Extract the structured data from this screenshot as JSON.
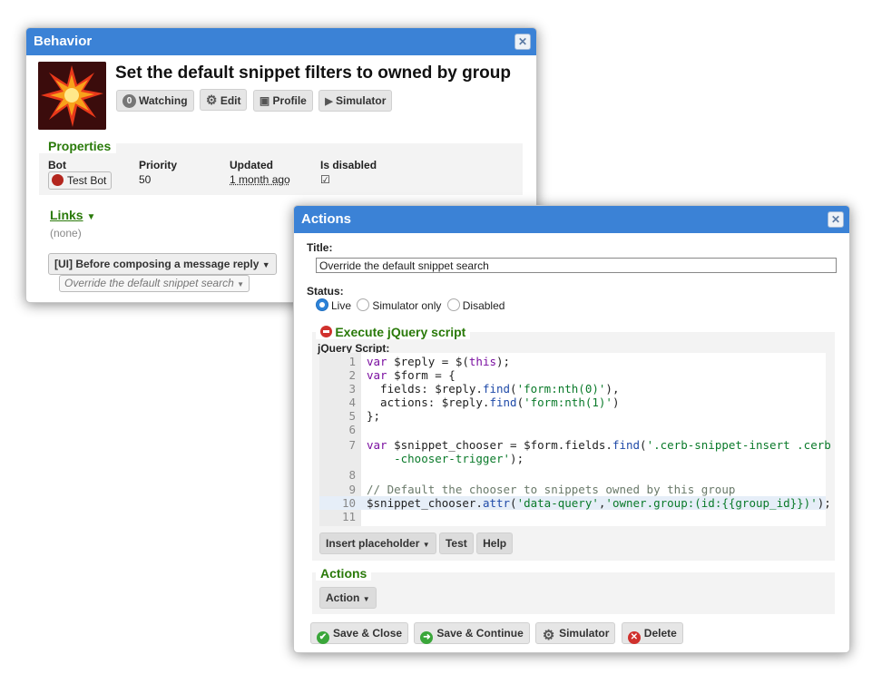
{
  "behavior": {
    "window_title": "Behavior",
    "title": "Set the default snippet filters to owned by group",
    "toolbar": {
      "watching_count": "0",
      "watching_label": "Watching",
      "edit_label": "Edit",
      "profile_label": "Profile",
      "simulator_label": "Simulator"
    },
    "properties": {
      "legend": "Properties",
      "bot_label": "Bot",
      "bot_value": "Test Bot",
      "priority_label": "Priority",
      "priority_value": "50",
      "updated_label": "Updated",
      "updated_value": "1 month ago",
      "disabled_label": "Is disabled",
      "disabled_value": "☑"
    },
    "links_label": "Links",
    "links_value": "(none)",
    "event_label": "[UI] Before composing a message reply",
    "node_label": "Override the default snippet search"
  },
  "actions": {
    "window_title": "Actions",
    "title_label": "Title:",
    "title_value": "Override the default snippet search",
    "status_label": "Status:",
    "status_options": [
      "Live",
      "Simulator only",
      "Disabled"
    ],
    "status_selected": "Live",
    "exec_legend": "Execute jQuery script",
    "script_label": "jQuery Script:",
    "code_lines": [
      "var $reply = $(this);",
      "var $form = {",
      "  fields: $reply.find('form:nth(0)'),",
      "  actions: $reply.find('form:nth(1)')",
      "};",
      "",
      "var $snippet_chooser = $form.fields.find('.cerb-snippet-insert .cerb",
      "    -chooser-trigger');",
      "",
      "// Default the chooser to snippets owned by this group",
      "$snippet_chooser.attr('data-query','owner.group:(id:{{group_id}})');",
      ""
    ],
    "line_numbers": [
      "1",
      "2",
      "3",
      "4",
      "5",
      "6",
      "7",
      "",
      "8",
      "9",
      "10",
      "11"
    ],
    "insert_placeholder_label": "Insert placeholder",
    "test_label": "Test",
    "help_label": "Help",
    "actions_legend": "Actions",
    "action_button_label": "Action",
    "footer": {
      "save_close": "Save & Close",
      "save_continue": "Save & Continue",
      "simulator": "Simulator",
      "delete": "Delete"
    }
  },
  "colors": {
    "titlebar": "#3b82d6",
    "section_green": "#2a7a0a",
    "delete_red": "#d0312d",
    "save_green": "#3aa63a"
  }
}
